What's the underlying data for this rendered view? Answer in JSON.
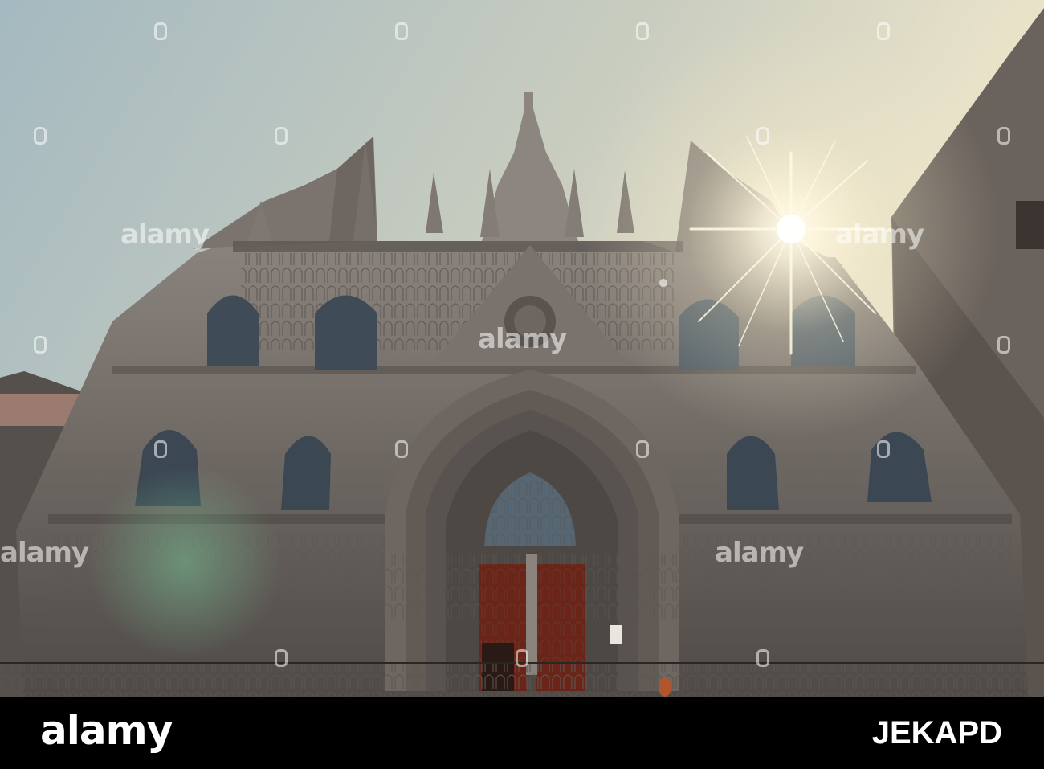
{
  "photo": {
    "subject": "cathedral facade",
    "colors": {
      "sky_left": "#a9bcc2",
      "sky_right": "#e6dfc8",
      "stone": "#6f6a66",
      "doors": "#6b2418"
    }
  },
  "watermark": {
    "text": "alamy"
  },
  "footer": {
    "logo": "alamy",
    "image_id": "JEKAPD"
  }
}
